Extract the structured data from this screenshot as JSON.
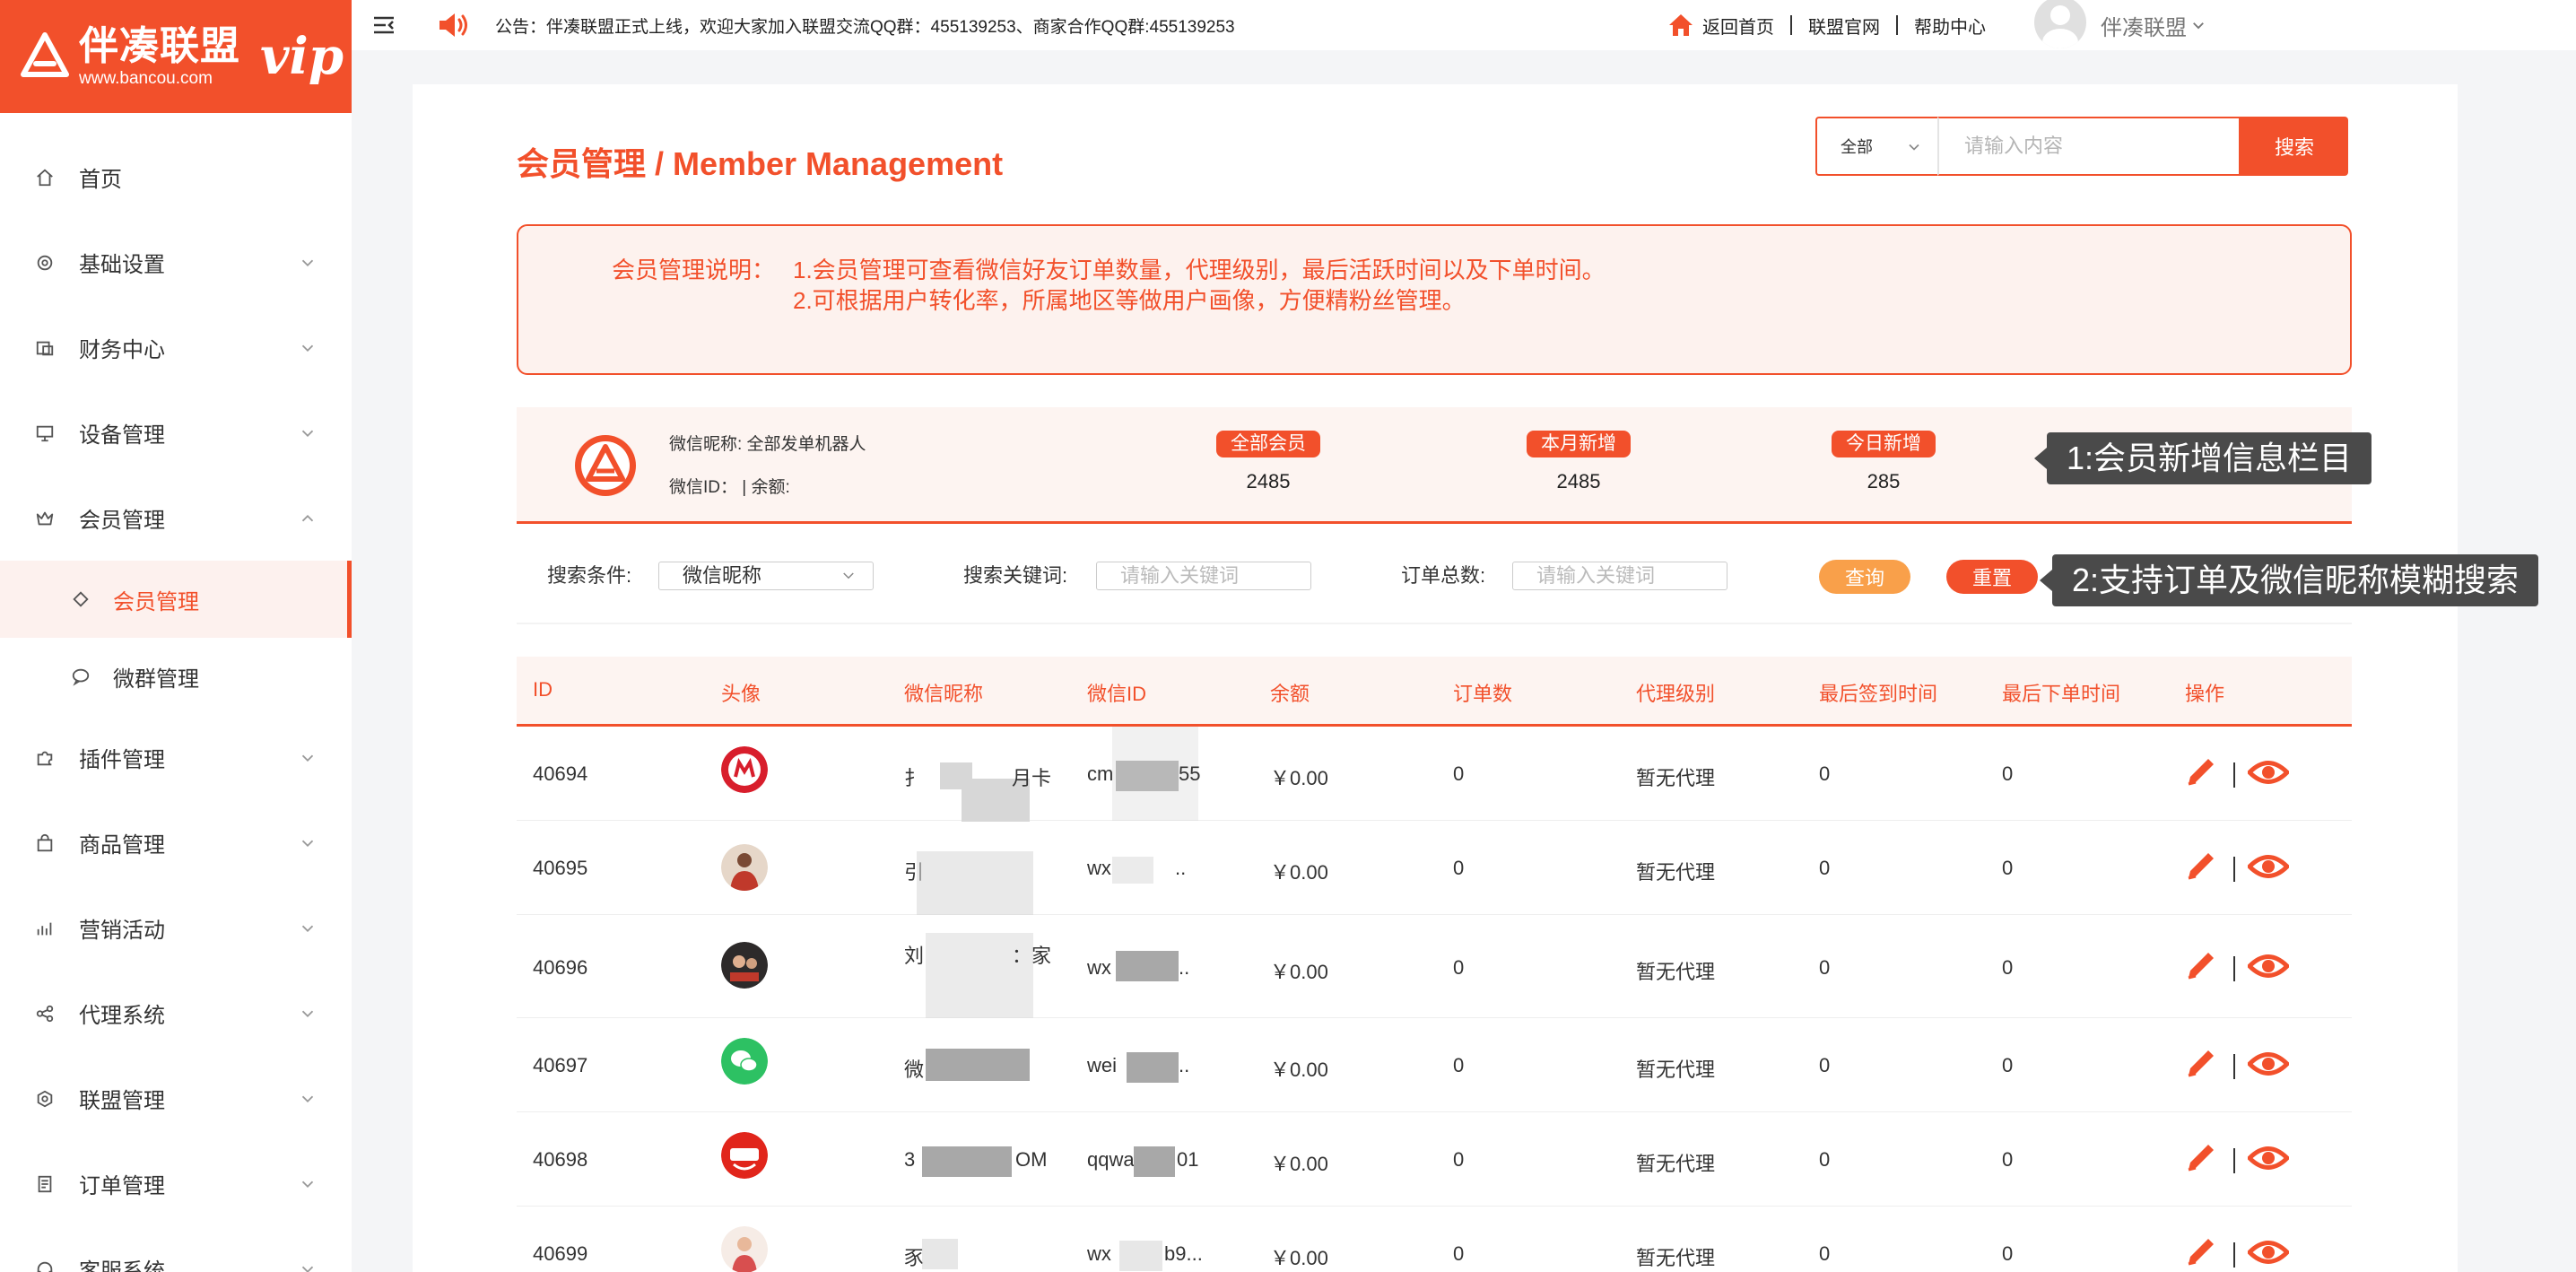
{
  "brand": {
    "name": "伴凑联盟",
    "url": "www.bancou.com",
    "vip": "vip",
    "accent_color": "#f2502b"
  },
  "sidebar": {
    "items": [
      {
        "label": "首页",
        "icon": "home-icon"
      },
      {
        "label": "基础设置",
        "icon": "gear-icon"
      },
      {
        "label": "财务中心",
        "icon": "finance-icon"
      },
      {
        "label": "设备管理",
        "icon": "monitor-icon"
      },
      {
        "label": "会员管理",
        "icon": "crown-icon"
      },
      {
        "label": "插件管理",
        "icon": "puzzle-icon"
      },
      {
        "label": "商品管理",
        "icon": "bag-icon"
      },
      {
        "label": "营销活动",
        "icon": "chart-icon"
      },
      {
        "label": "代理系统",
        "icon": "share-icon"
      },
      {
        "label": "联盟管理",
        "icon": "hexagon-icon"
      },
      {
        "label": "订单管理",
        "icon": "document-icon"
      },
      {
        "label": "客服系统",
        "icon": "headset-icon"
      }
    ],
    "sub_items": [
      {
        "label": "会员管理",
        "icon": "diamond-icon",
        "active": true
      },
      {
        "label": "微群管理",
        "icon": "chat-icon",
        "active": false
      }
    ]
  },
  "topbar": {
    "notice": "公告：伴凑联盟正式上线，欢迎大家加入联盟交流QQ群：455139253、商家合作QQ群:455139253",
    "links": [
      "返回首页",
      "联盟官网",
      "帮助中心"
    ],
    "user_name": "伴凑联盟"
  },
  "page": {
    "title": "会员管理 / Member Management"
  },
  "search": {
    "scope": "全部",
    "placeholder": "请输入内容",
    "button": "搜索"
  },
  "description": {
    "label": "会员管理说明：",
    "line1": "1.会员管理可查看微信好友订单数量，代理级别，最后活跃时间以及下单时间。",
    "line2": "2.可根据用户转化率，所属地区等做用户画像，方便精粉丝管理。"
  },
  "stats": {
    "nickname": "微信昵称: 全部发单机器人",
    "id_line": "微信ID：   |  余额:",
    "items": [
      {
        "label": "全部会员",
        "value": "2485"
      },
      {
        "label": "本月新增",
        "value": "2485"
      },
      {
        "label": "今日新增",
        "value": "285"
      }
    ]
  },
  "filters": {
    "condition_label": "搜索条件:",
    "condition_value": "微信昵称",
    "keyword_label": "搜索关键词:",
    "keyword_placeholder": "请输入关键词",
    "orders_label": "订单总数:",
    "orders_placeholder": "请输入关键词",
    "query_button": "查询",
    "reset_button": "重置"
  },
  "callouts": {
    "stats": "1:会员新增信息栏目",
    "filters": "2:支持订单及微信昵称模糊搜索"
  },
  "table": {
    "columns": [
      "ID",
      "头像",
      "微信昵称",
      "微信ID",
      "余额",
      "订单数",
      "代理级别",
      "最后签到时间",
      "最后下单时间",
      "操作"
    ],
    "rows": [
      {
        "id": "40694",
        "avatar": "brand-red-icon",
        "nick": "扌",
        "nick_tail": "月卡",
        "wxid": "cm",
        "wxid_tail": "55",
        "balance": "￥0.00",
        "orders": "0",
        "level": "暂无代理",
        "last_sign": "0",
        "last_order": "0"
      },
      {
        "id": "40695",
        "avatar": "person-icon",
        "nick": "引",
        "nick_tail": "",
        "wxid": "wx",
        "wxid_tail": "..",
        "balance": "￥0.00",
        "orders": "0",
        "level": "暂无代理",
        "last_sign": "0",
        "last_order": "0"
      },
      {
        "id": "40696",
        "avatar": "person-dark-icon",
        "nick": "刘",
        "nick_tail": "：家",
        "wxid": "wx",
        "wxid_tail": "..",
        "balance": "￥0.00",
        "orders": "0",
        "level": "暂无代理",
        "last_sign": "0",
        "last_order": "0"
      },
      {
        "id": "40697",
        "avatar": "wechat-icon",
        "nick": "微",
        "nick_tail": "",
        "wxid": "wei",
        "wxid_tail": "..",
        "balance": "￥0.00",
        "orders": "0",
        "level": "暂无代理",
        "last_sign": "0",
        "last_order": "0"
      },
      {
        "id": "40698",
        "avatar": "jd-icon",
        "nick": "3",
        "nick_tail": "OM",
        "wxid": "qqwa",
        "wxid_tail": "01",
        "balance": "￥0.00",
        "orders": "0",
        "level": "暂无代理",
        "last_sign": "0",
        "last_order": "0"
      },
      {
        "id": "40699",
        "avatar": "person-light-icon",
        "nick": "豕",
        "nick_tail": "",
        "wxid": "wx",
        "wxid_tail": "b9...",
        "balance": "￥0.00",
        "orders": "0",
        "level": "暂无代理",
        "last_sign": "0",
        "last_order": "0"
      }
    ]
  }
}
